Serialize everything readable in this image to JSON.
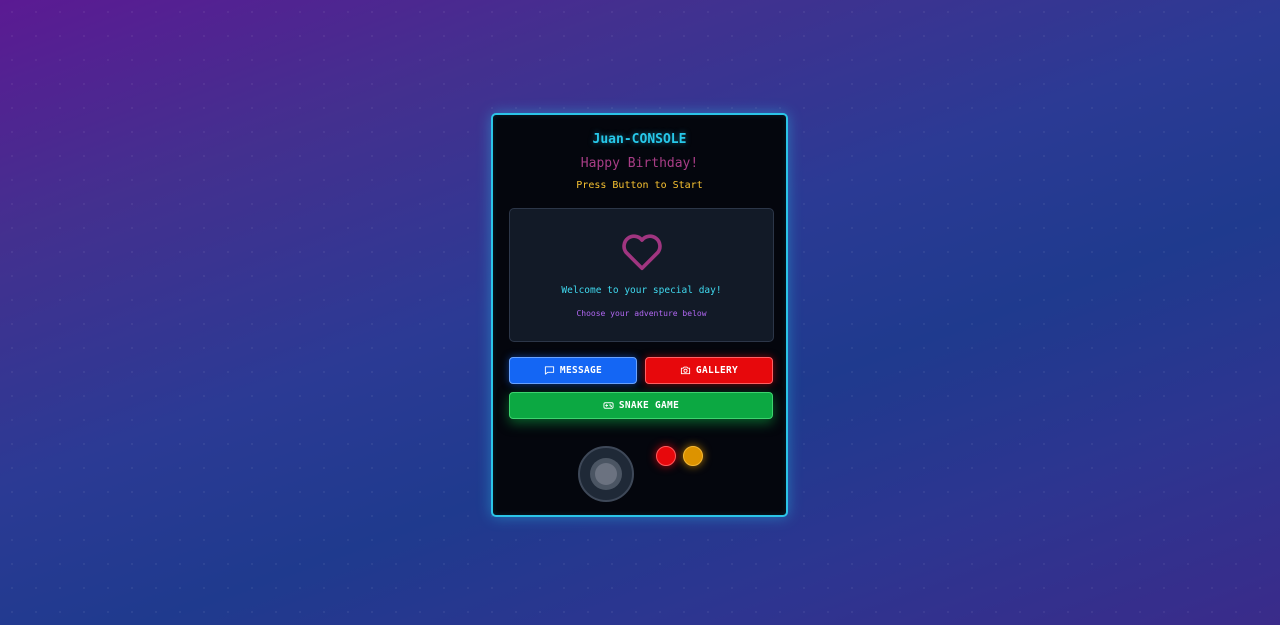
{
  "console": {
    "title": "Juan-CONSOLE",
    "subtitle": "Happy Birthday!",
    "prompt": "Press Button to Start"
  },
  "screen": {
    "icon": "heart-icon",
    "welcome": "Welcome to your special day!",
    "instruction": "Choose your adventure below"
  },
  "buttons": {
    "message": {
      "label": "MESSAGE",
      "icon": "message-icon",
      "color": "#1466f4"
    },
    "gallery": {
      "label": "GALLERY",
      "icon": "camera-icon",
      "color": "#e7080c"
    },
    "snake": {
      "label": "SNAKE GAME",
      "icon": "gamepad-icon",
      "color": "#0ca842"
    }
  },
  "controls": {
    "a_button_color": "#e7080c",
    "b_button_color": "#dd9300"
  },
  "colors": {
    "accent": "#27c8ea",
    "subtitle": "#a83d86",
    "prompt": "#f7c131"
  }
}
